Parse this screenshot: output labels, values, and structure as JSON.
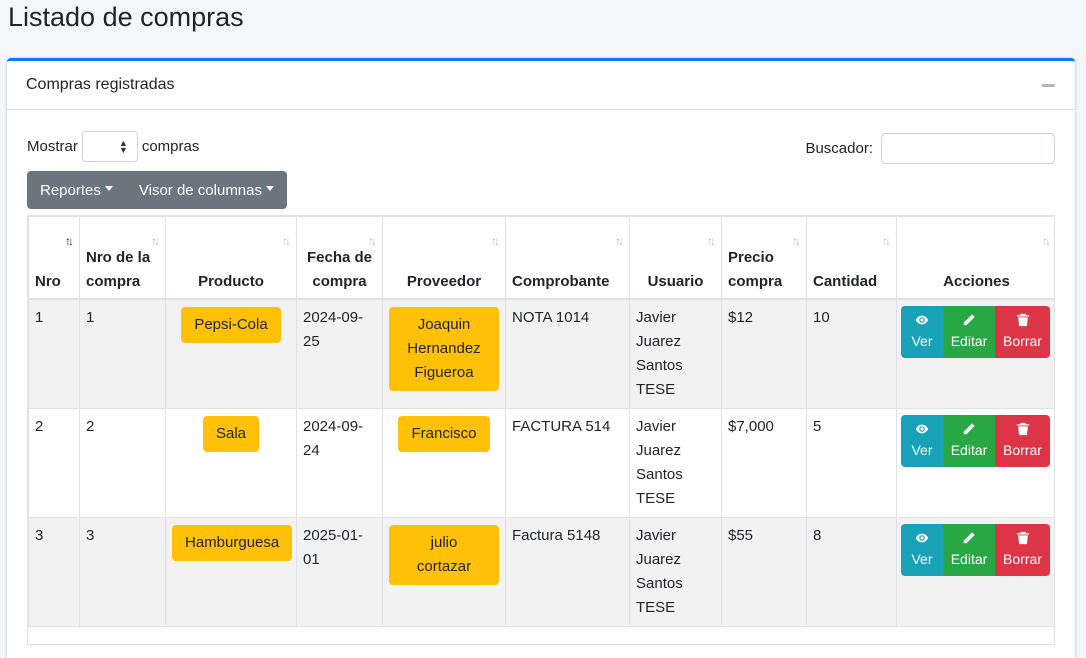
{
  "page": {
    "title": "Listado de compras"
  },
  "card": {
    "title": "Compras registradas"
  },
  "controls": {
    "show_label": "Mostrar",
    "show_suffix": "compras",
    "search_label": "Buscador:",
    "search_value": ""
  },
  "toolbar": {
    "reportes": "Reportes",
    "visor": "Visor de columnas"
  },
  "table": {
    "headers": [
      "Nro",
      "Nro de la compra",
      "Producto",
      "Fecha de compra",
      "Proveedor",
      "Comprobante",
      "Usuario",
      "Precio compra",
      "Cantidad",
      "Acciones"
    ],
    "rows": [
      {
        "nro": "1",
        "nro_compra": "1",
        "producto": "Pepsi-Cola",
        "fecha": "2024-09-25",
        "proveedor": "Joaquin Hernandez Figueroa",
        "comprobante": "NOTA 1014",
        "usuario": "Javier Juarez Santos TESE",
        "precio": "$12",
        "cantidad": "10"
      },
      {
        "nro": "2",
        "nro_compra": "2",
        "producto": "Sala",
        "fecha": "2024-09-24",
        "proveedor": "Francisco",
        "comprobante": "FACTURA 514",
        "usuario": "Javier Juarez Santos TESE",
        "precio": "$7,000",
        "cantidad": "5"
      },
      {
        "nro": "3",
        "nro_compra": "3",
        "producto": "Hamburguesa",
        "fecha": "2025-01-01",
        "proveedor": "julio cortazar",
        "comprobante": "Factura 5148",
        "usuario": "Javier Juarez Santos TESE",
        "precio": "$55",
        "cantidad": "8"
      }
    ],
    "actions": {
      "ver": "Ver",
      "editar": "Editar",
      "borrar": "Borrar"
    }
  },
  "colors": {
    "accent": "#007bff",
    "warning": "#ffc107",
    "info": "#17a2b8",
    "success": "#28a745",
    "danger": "#dc3545",
    "secondary": "#6c757d"
  }
}
